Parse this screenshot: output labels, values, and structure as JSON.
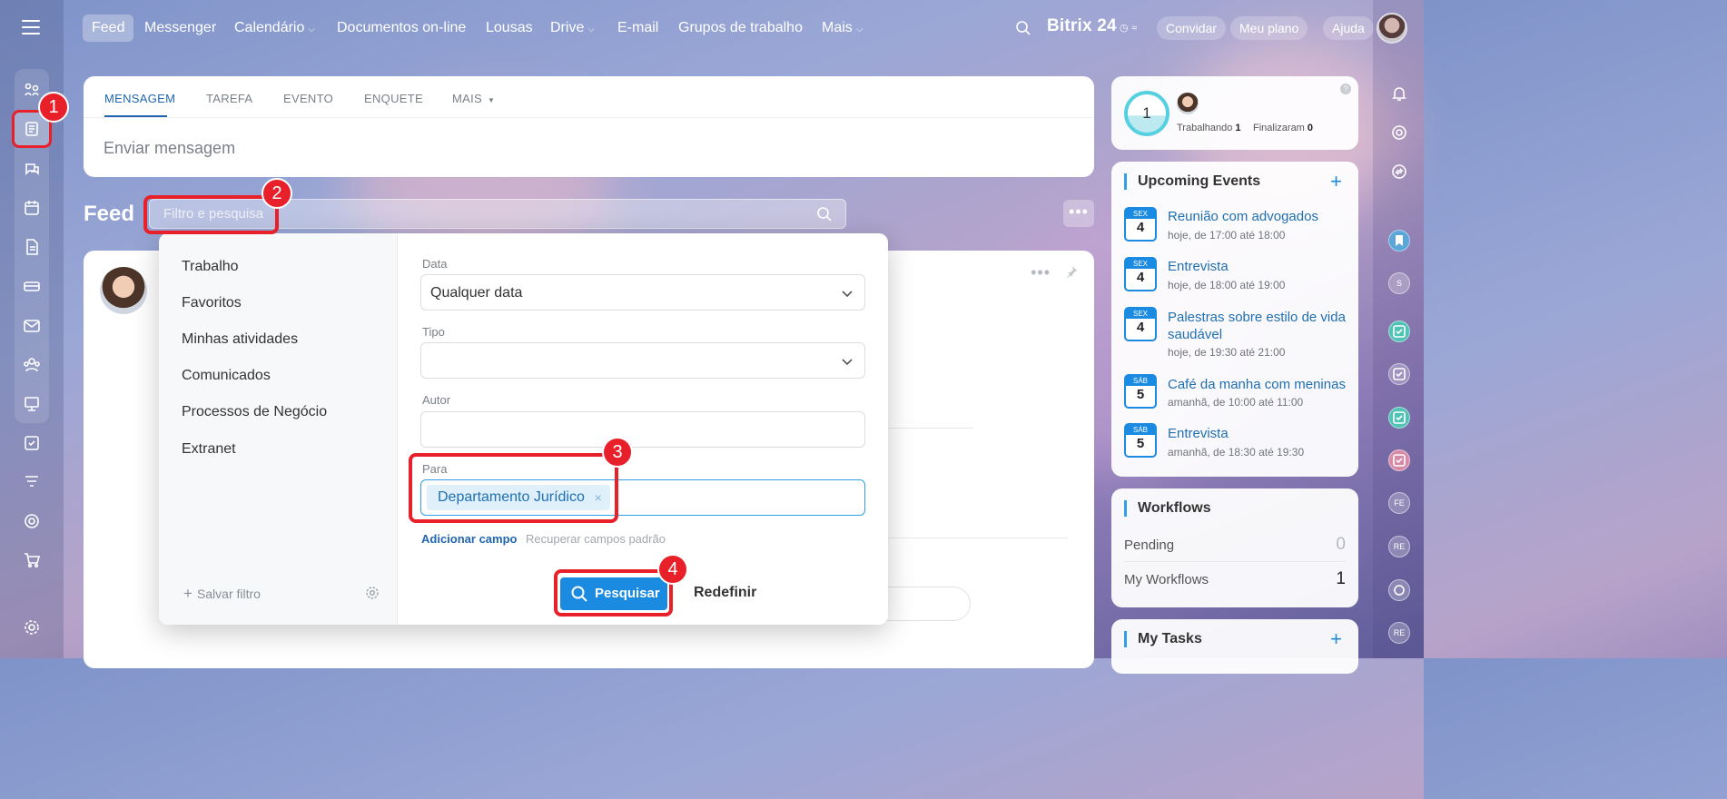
{
  "topnav": {
    "items": [
      {
        "label": "Feed",
        "active": true
      },
      {
        "label": "Messenger"
      },
      {
        "label": "Calendário",
        "has_menu": true
      },
      {
        "label": "Documentos on-line"
      },
      {
        "label": "Lousas"
      },
      {
        "label": "Drive",
        "has_menu": true
      },
      {
        "label": "E-mail"
      },
      {
        "label": "Grupos de trabalho"
      },
      {
        "label": "Mais",
        "has_menu": true
      }
    ],
    "brand": "Bitrix 24",
    "invite": "Convidar",
    "plan": "Meu plano",
    "help": "Ajuda"
  },
  "composer": {
    "tabs": [
      "MENSAGEM",
      "TAREFA",
      "EVENTO",
      "ENQUETE",
      "MAIS"
    ],
    "placeholder": "Enviar mensagem"
  },
  "feed": {
    "title": "Feed",
    "filter_placeholder": "Filtro e pesquisa"
  },
  "filter_popup": {
    "presets": [
      "Trabalho",
      "Favoritos",
      "Minhas atividades",
      "Comunicados",
      "Processos de Negócio",
      "Extranet"
    ],
    "save_filter": "Salvar filtro",
    "fields": {
      "date_label": "Data",
      "date_value": "Qualquer data",
      "type_label": "Tipo",
      "type_value": "",
      "author_label": "Autor",
      "author_value": "",
      "to_label": "Para",
      "to_chip": "Departamento Jurídico",
      "chip_remove": "×"
    },
    "add_field": "Adicionar campo",
    "restore_fields": "Recuperar campos padrão",
    "search_button": "Pesquisar",
    "reset_button": "Redefinir"
  },
  "annotations": [
    "1",
    "2",
    "3",
    "4"
  ],
  "worktime": {
    "count": "1",
    "working_label": "Trabalhando",
    "working_count": "1",
    "finished_label": "Finalizaram",
    "finished_count": "0",
    "help": "?"
  },
  "upcoming_events": {
    "title": "Upcoming Events",
    "add": "+",
    "events": [
      {
        "day": "SEX",
        "date": "4",
        "title": "Reunião com advogados",
        "time": "hoje, de 17:00 até 18:00"
      },
      {
        "day": "SEX",
        "date": "4",
        "title": "Entrevista",
        "time": "hoje, de 18:00 até 19:00"
      },
      {
        "day": "SEX",
        "date": "4",
        "title": "Palestras sobre estilo de vida saudável",
        "time": "hoje, de 19:30 até 21:00"
      },
      {
        "day": "SÁB",
        "date": "5",
        "title": "Café da manha com meninas",
        "time": "amanhã, de 10:00 até 11:00"
      },
      {
        "day": "SÁB",
        "date": "5",
        "title": "Entrevista",
        "time": "amanhã, de 18:30 até 19:30"
      }
    ]
  },
  "workflows": {
    "title": "Workflows",
    "rows": [
      {
        "label": "Pending",
        "value": "0"
      },
      {
        "label": "My Workflows",
        "value": "1"
      }
    ]
  },
  "my_tasks": {
    "title": "My Tasks",
    "add": "+"
  },
  "right_rail": {
    "badges": [
      "S",
      "FE",
      "RE",
      "RE"
    ]
  },
  "colors": {
    "accent": "#1a8be0",
    "annotation": "#e8202a",
    "link": "#1f6fb3"
  }
}
